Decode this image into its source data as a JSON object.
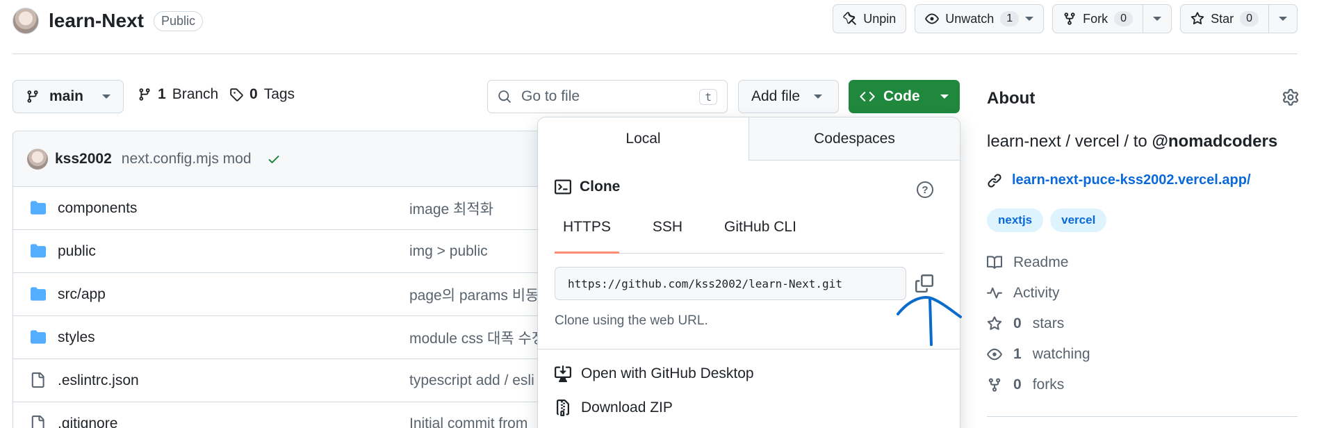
{
  "repo": {
    "name": "learn-Next",
    "visibility": "Public"
  },
  "header_actions": {
    "unpin": "Unpin",
    "unwatch": "Unwatch",
    "watch_count": "1",
    "fork": "Fork",
    "fork_count": "0",
    "star": "Star",
    "star_count": "0"
  },
  "branch_bar": {
    "branch": "main",
    "branches_count": "1",
    "branches_label": "Branch",
    "tags_count": "0",
    "tags_label": "Tags",
    "goto_placeholder": "Go to file",
    "goto_shortcut": "t",
    "add_file": "Add file",
    "code": "Code"
  },
  "latest_commit": {
    "author": "kss2002",
    "message": "next.config.mjs mod"
  },
  "files": [
    {
      "name": "components",
      "type": "folder",
      "message": "image 최적화"
    },
    {
      "name": "public",
      "type": "folder",
      "message": "img > public"
    },
    {
      "name": "src/app",
      "type": "folder",
      "message": "page의 params 비동"
    },
    {
      "name": "styles",
      "type": "folder",
      "message": "module css 대폭 수정"
    },
    {
      "name": ".eslintrc.json",
      "type": "file",
      "message": "typescript add / esli"
    },
    {
      "name": ".gitignore",
      "type": "file",
      "message": "Initial commit from"
    }
  ],
  "clone_panel": {
    "tab_local": "Local",
    "tab_codespaces": "Codespaces",
    "clone_title": "Clone",
    "help": "?",
    "protocols": [
      "HTTPS",
      "SSH",
      "GitHub CLI"
    ],
    "url": "https://github.com/kss2002/learn-Next.git",
    "hint": "Clone using the web URL.",
    "open_desktop": "Open with GitHub Desktop",
    "download_zip": "Download ZIP"
  },
  "about": {
    "title": "About",
    "description_prefix": "learn-next / vercel / to ",
    "description_mention": "@nomadcoders",
    "homepage": "learn-next-puce-kss2002.vercel.app/",
    "topics": [
      "nextjs",
      "vercel"
    ],
    "readme": "Readme",
    "activity": "Activity",
    "stars_count": "0",
    "stars_label": "stars",
    "watching_count": "1",
    "watching_label": "watching",
    "forks_count": "0",
    "forks_label": "forks"
  },
  "colors": {
    "accent_green": "#1f883d",
    "link_blue": "#0969da",
    "tab_underline": "#fd8c73",
    "annotation_blue": "#0b6bcb",
    "folder_blue": "#54aeff"
  }
}
